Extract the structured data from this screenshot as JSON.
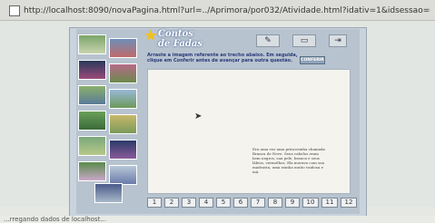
{
  "browser": {
    "url": "http://localhost:8090/novaPagina.html?url=../Aprimora/por032/Atividade.html?idativ=1&idsessao=0&modo=n&a",
    "status": "...rregando dados de localhost..."
  },
  "app": {
    "logo_line1": "Contos",
    "logo_line2": "de Fadas"
  },
  "toolbar": {
    "pen_icon": "pen-icon",
    "eraser_icon": "eraser-icon",
    "exit_icon": "exit-icon"
  },
  "activity": {
    "instruction": "Arraste a imagem referente ao trecho abaixo. Em seguida, clique em Conferir antes de avançar para outra questão.",
    "confer_label": "CONFERIR",
    "story_text": "Era uma vez uma princesinha chamada Branca de Neve. Seus cabelos eram bem negros, sua pele, branca e seus lábios, vermelhos. Ela morava com sua madrasta, uma rainha muito vaidosa e má."
  },
  "pages": [
    "1",
    "2",
    "3",
    "4",
    "5",
    "6",
    "7",
    "8",
    "9",
    "10",
    "11",
    "12"
  ],
  "colors": {
    "canvas": "#f4f3ee",
    "frame": "#b7c3cf",
    "instruction": "#2a3a7a"
  }
}
